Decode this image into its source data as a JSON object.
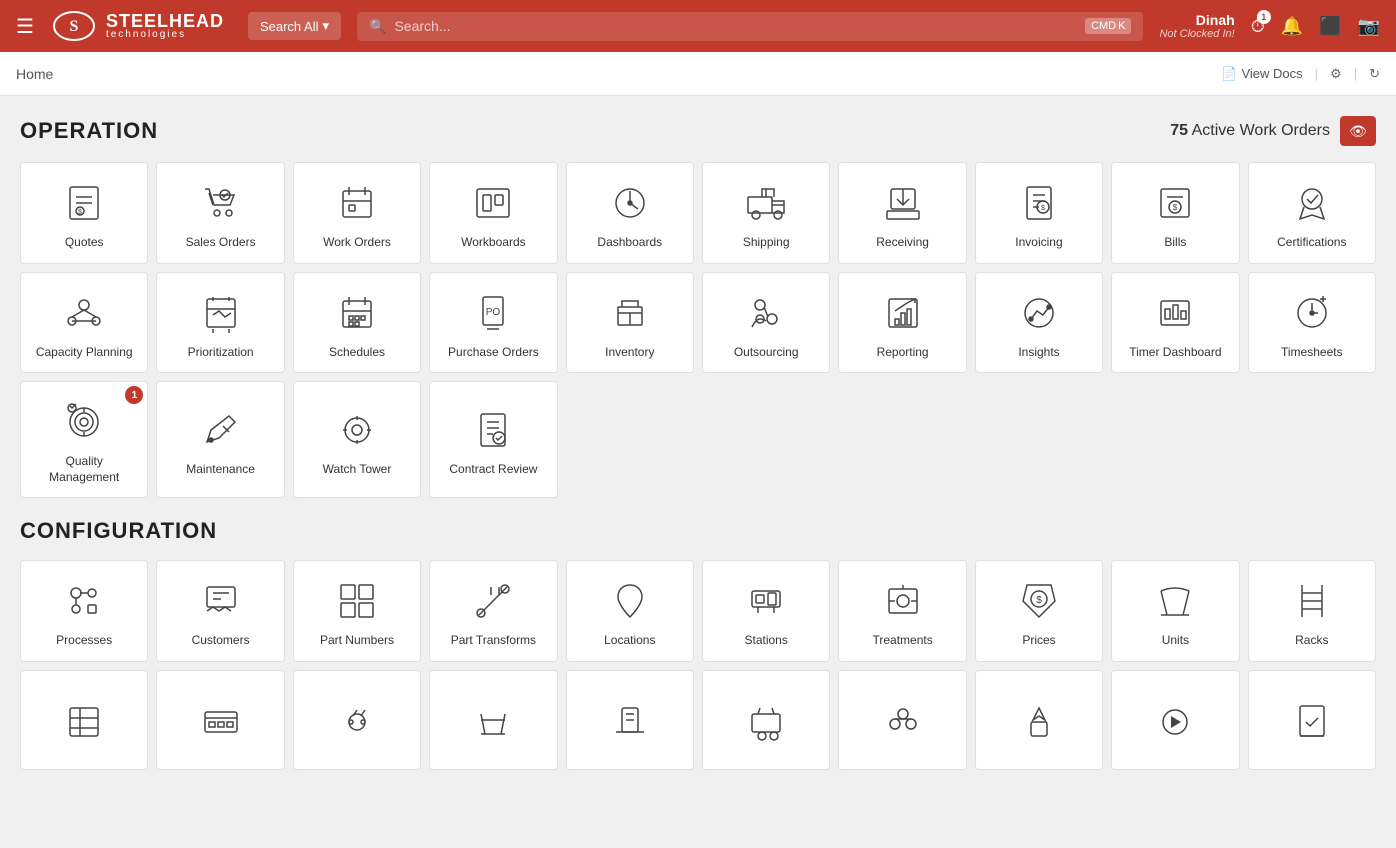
{
  "header": {
    "menu_icon": "☰",
    "brand": "STEELHEAD",
    "sub": "technologies",
    "search_all": "Search All",
    "search_placeholder": "Search...",
    "kbd1": "CMD",
    "kbd2": "K",
    "user_name": "Dinah",
    "user_status": "Not Clocked In!",
    "timer_count": "1"
  },
  "breadcrumb": {
    "home": "Home",
    "view_docs": "View Docs"
  },
  "operation": {
    "title": "OPERATION",
    "active_orders_count": "75",
    "active_orders_label": "Active Work Orders",
    "cards": [
      {
        "id": "quotes",
        "label": "Quotes",
        "badge": null
      },
      {
        "id": "sales-orders",
        "label": "Sales Orders",
        "badge": null
      },
      {
        "id": "work-orders",
        "label": "Work Orders",
        "badge": null
      },
      {
        "id": "workboards",
        "label": "Workboards",
        "badge": null
      },
      {
        "id": "dashboards",
        "label": "Dashboards",
        "badge": null
      },
      {
        "id": "shipping",
        "label": "Shipping",
        "badge": null
      },
      {
        "id": "receiving",
        "label": "Receiving",
        "badge": null
      },
      {
        "id": "invoicing",
        "label": "Invoicing",
        "badge": null
      },
      {
        "id": "bills",
        "label": "Bills",
        "badge": null
      },
      {
        "id": "certifications",
        "label": "Certifications",
        "badge": null
      },
      {
        "id": "capacity-planning",
        "label": "Capacity Planning",
        "badge": null
      },
      {
        "id": "prioritization",
        "label": "Prioritization",
        "badge": null
      },
      {
        "id": "schedules",
        "label": "Schedules",
        "badge": null
      },
      {
        "id": "purchase-orders",
        "label": "Purchase Orders",
        "badge": null
      },
      {
        "id": "inventory",
        "label": "Inventory",
        "badge": null
      },
      {
        "id": "outsourcing",
        "label": "Outsourcing",
        "badge": null
      },
      {
        "id": "reporting",
        "label": "Reporting",
        "badge": null
      },
      {
        "id": "insights",
        "label": "Insights",
        "badge": null
      },
      {
        "id": "timer-dashboard",
        "label": "Timer Dashboard",
        "badge": null
      },
      {
        "id": "timesheets",
        "label": "Timesheets",
        "badge": null
      },
      {
        "id": "quality-management",
        "label": "Quality Management",
        "badge": "1"
      },
      {
        "id": "maintenance",
        "label": "Maintenance",
        "badge": null
      },
      {
        "id": "watch-tower",
        "label": "Watch Tower",
        "badge": null
      },
      {
        "id": "contract-review",
        "label": "Contract Review",
        "badge": null
      }
    ]
  },
  "configuration": {
    "title": "CONFIGURATION",
    "cards": [
      {
        "id": "processes",
        "label": "Processes",
        "badge": null
      },
      {
        "id": "customers",
        "label": "Customers",
        "badge": null
      },
      {
        "id": "part-numbers",
        "label": "Part Numbers",
        "badge": null
      },
      {
        "id": "part-transforms",
        "label": "Part Transforms",
        "badge": null
      },
      {
        "id": "locations",
        "label": "Locations",
        "badge": null
      },
      {
        "id": "stations",
        "label": "Stations",
        "badge": null
      },
      {
        "id": "treatments",
        "label": "Treatments",
        "badge": null
      },
      {
        "id": "prices",
        "label": "Prices",
        "badge": null
      },
      {
        "id": "units",
        "label": "Units",
        "badge": null
      },
      {
        "id": "racks",
        "label": "Racks",
        "badge": null
      },
      {
        "id": "row11-1",
        "label": "",
        "badge": null
      },
      {
        "id": "row11-2",
        "label": "",
        "badge": null
      },
      {
        "id": "row11-3",
        "label": "",
        "badge": null
      },
      {
        "id": "row11-4",
        "label": "",
        "badge": null
      },
      {
        "id": "row11-5",
        "label": "",
        "badge": null
      },
      {
        "id": "row11-6",
        "label": "",
        "badge": null
      },
      {
        "id": "row11-7",
        "label": "",
        "badge": null
      },
      {
        "id": "row11-8",
        "label": "",
        "badge": null
      },
      {
        "id": "row11-9",
        "label": "",
        "badge": null
      },
      {
        "id": "row11-10",
        "label": "",
        "badge": null
      }
    ]
  }
}
